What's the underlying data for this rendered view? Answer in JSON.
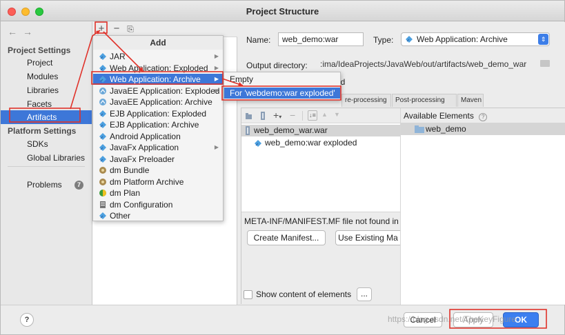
{
  "window": {
    "title": "Project Structure"
  },
  "sidebar": {
    "back_arrow": "←",
    "forward_arrow": "→",
    "project_settings_heading": "Project Settings",
    "project_items": [
      "Project",
      "Modules",
      "Libraries",
      "Facets",
      "Artifacts"
    ],
    "selected": "Artifacts",
    "platform_settings_heading": "Platform Settings",
    "platform_items": [
      "SDKs",
      "Global Libraries"
    ],
    "problems_label": "Problems",
    "problems_count": "7"
  },
  "mid_toolbar": {
    "add": "+",
    "remove": "−",
    "copy": "⎘"
  },
  "add_menu": {
    "title": "Add",
    "items": [
      {
        "label": "JAR",
        "submenu": true,
        "icon": "diamond-icon"
      },
      {
        "label": "Web Application: Exploded",
        "submenu": true,
        "icon": "diamond-icon"
      },
      {
        "label": "Web Application: Archive",
        "submenu": true,
        "icon": "diamond-icon",
        "highlighted": true
      },
      {
        "label": "JavaEE Application: Exploded",
        "submenu": true,
        "icon": "javaee-icon"
      },
      {
        "label": "JavaEE Application: Archive",
        "submenu": false,
        "icon": "javaee-icon"
      },
      {
        "label": "EJB Application: Exploded",
        "submenu": false,
        "icon": "diamond-icon"
      },
      {
        "label": "EJB Application: Archive",
        "submenu": false,
        "icon": "diamond-icon"
      },
      {
        "label": "Android Application",
        "submenu": false,
        "icon": "android-icon"
      },
      {
        "label": "JavaFx Application",
        "submenu": true,
        "icon": "diamond-icon"
      },
      {
        "label": "JavaFx Preloader",
        "submenu": false,
        "icon": "diamond-icon"
      },
      {
        "label": "dm Bundle",
        "submenu": false,
        "icon": "bundle-icon"
      },
      {
        "label": "dm Platform Archive",
        "submenu": false,
        "icon": "bundle-icon"
      },
      {
        "label": "dm Plan",
        "submenu": false,
        "icon": "plan-icon"
      },
      {
        "label": "dm Configuration",
        "submenu": false,
        "icon": "config-icon"
      },
      {
        "label": "Other",
        "submenu": false,
        "icon": "diamond-icon"
      }
    ]
  },
  "sub_menu": {
    "items": [
      "Empty",
      "For 'webdemo:war exploded'"
    ],
    "highlighted": "For 'webdemo:war exploded'"
  },
  "form": {
    "name_label": "Name:",
    "name_value": "web_demo:war",
    "type_label": "Type:",
    "type_value": "Web Application: Archive",
    "output_label": "Output directory:",
    "output_value": ":ima/IdeaProjects/JavaWeb/out/artifacts/web_demo_war",
    "build_partial": "ld"
  },
  "tabs": [
    "re-processing",
    "Post-processing",
    "Maven"
  ],
  "output_tree": {
    "rows": [
      "web_demo_war.war",
      "web_demo:war exploded"
    ]
  },
  "available": {
    "heading": "Available Elements",
    "rows": [
      "web_demo"
    ]
  },
  "manifest": {
    "message": "META-INF/MANIFEST.MF file not found in",
    "create_button": "Create Manifest...",
    "use_existing_button": "Use Existing Ma"
  },
  "show_content": {
    "label": "Show content of elements",
    "more_button": "..."
  },
  "footer": {
    "help": "?",
    "cancel": "Cancel",
    "apply": "Apply",
    "ok": "OK"
  },
  "watermark": "https://blog.csdn.net/TheKeyFigure",
  "colors": {
    "selection": "#3d77d8",
    "annotation": "#e0322a",
    "ok_button": "#3c7ff0"
  }
}
